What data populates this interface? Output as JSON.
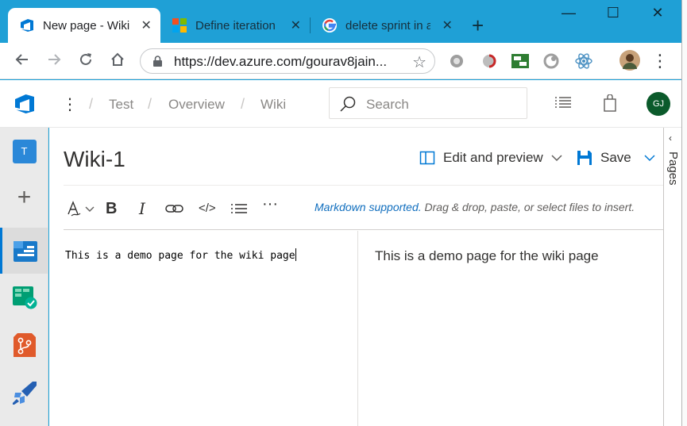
{
  "browser": {
    "tabs": [
      {
        "title": "New page - Wiki",
        "close": "✕",
        "active": true
      },
      {
        "title": "Define iteration",
        "close": "✕",
        "active": false
      },
      {
        "title": "delete sprint in a",
        "close": "✕",
        "active": false
      }
    ],
    "new_tab": "+",
    "window_controls": {
      "minimize": "—",
      "maximize": "☐",
      "close": "✕"
    },
    "url": "https://dev.azure.com/gourav8jain...",
    "menu": "⋮"
  },
  "header": {
    "menu_dots": "⋮",
    "breadcrumbs": [
      "Test",
      "Overview",
      "Wiki"
    ],
    "separator": "/",
    "search_placeholder": "Search",
    "user_initials": "GJ"
  },
  "leftnav": {
    "project_initial": "T",
    "add": "+"
  },
  "page": {
    "title": "Wiki-1",
    "view_mode": "Edit and preview",
    "save_label": "Save"
  },
  "format_toolbar": {
    "bold": "B",
    "italic": "I",
    "code": "</>",
    "more": "···",
    "markdown_link": "Markdown supported.",
    "hint": " Drag & drop, paste, or select files to insert."
  },
  "editor": {
    "text": "This is a demo page for the wiki page"
  },
  "preview": {
    "text": "This is a demo page for the wiki page"
  },
  "pages_panel": {
    "label": "Pages",
    "chevron": "‹"
  },
  "colors": {
    "tab_strip": "#1fa0d6",
    "accent": "#0078d4",
    "avatar_bg": "#0b5a2b"
  }
}
